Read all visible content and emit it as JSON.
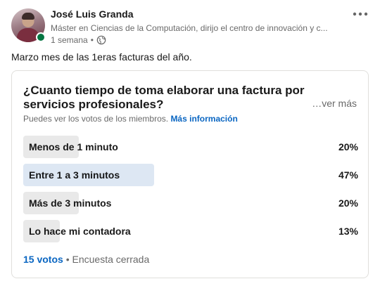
{
  "author": {
    "name": "José Luis Granda",
    "headline": "Máster en Ciencias de la Computación, dirijo el centro de innovación y c...",
    "time": "1 semana",
    "separator": "•",
    "visibility_icon": "globe-icon",
    "online": true
  },
  "post": {
    "text": "Marzo mes de las 1eras facturas del año.",
    "more_menu_icon": "ellipsis-icon"
  },
  "poll": {
    "question": "¿Cuanto tiempo de toma elaborar una factura por servicios profesionales?",
    "see_more": "…ver más",
    "visibility_text": "Puedes ver los votos de los miembros.",
    "more_info_link": "Más información",
    "options": [
      {
        "label": "Menos de 1 minuto",
        "percent_label": "20%",
        "percent": 20,
        "selected": false
      },
      {
        "label": "Entre 1 a 3 minutos",
        "percent_label": "47%",
        "percent": 47,
        "selected": true
      },
      {
        "label": "Más de 3 minutos",
        "percent_label": "20%",
        "percent": 20,
        "selected": false
      },
      {
        "label": "Lo hace mi contadora",
        "percent_label": "13%",
        "percent": 13,
        "selected": false
      }
    ],
    "votes": "15 votos",
    "footer_separator": "•",
    "status": "Encuesta cerrada"
  },
  "colors": {
    "link": "#0a66c2",
    "bar": "#e9e9e9",
    "bar_selected": "#dde7f3",
    "online": "#057642"
  }
}
